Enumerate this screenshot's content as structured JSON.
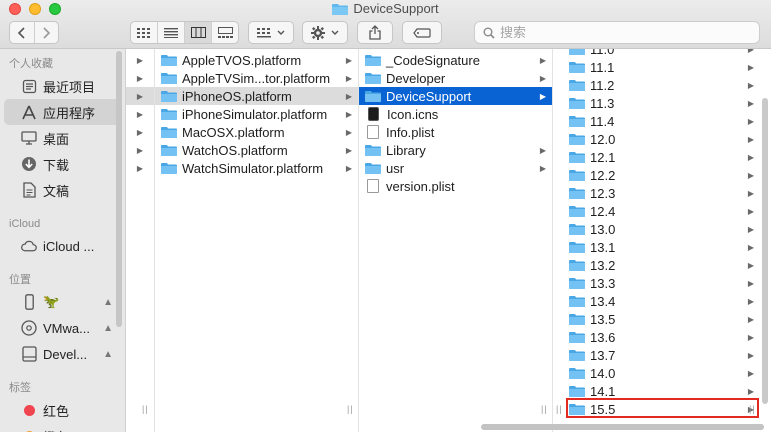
{
  "window": {
    "title": "DeviceSupport"
  },
  "toolbar": {
    "back_icon": "chevron-left-icon",
    "forward_icon": "chevron-right-icon",
    "view_icons": [
      "grid-view-icon",
      "list-view-icon",
      "column-view-icon",
      "gallery-view-icon"
    ],
    "active_view": "column",
    "search_placeholder": "搜索"
  },
  "sidebar": {
    "favorites_header": "个人收藏",
    "favorites": [
      {
        "label": "最近项目",
        "icon": "recents-icon"
      },
      {
        "label": "应用程序",
        "icon": "applications-icon",
        "selected": true
      },
      {
        "label": "桌面",
        "icon": "desktop-icon"
      },
      {
        "label": "下载",
        "icon": "downloads-icon"
      },
      {
        "label": "文稿",
        "icon": "documents-icon"
      }
    ],
    "icloud_header": "iCloud",
    "icloud": [
      {
        "label": "iCloud ...",
        "icon": "cloud-icon"
      }
    ],
    "locations_header": "位置",
    "locations": [
      {
        "label": "🦖",
        "icon": "iphone-icon"
      },
      {
        "label": "VMwa...",
        "icon": "disc-icon"
      },
      {
        "label": "Devel...",
        "icon": "drive-icon"
      }
    ],
    "tags_header": "标签",
    "tags": [
      {
        "label": "红色",
        "color": "#f0444e"
      },
      {
        "label": "橙色",
        "color": "#f5a030"
      }
    ]
  },
  "columns": {
    "platforms": [
      {
        "name": "AppleTVOS.platform"
      },
      {
        "name": "AppleTVSim...tor.platform"
      },
      {
        "name": "iPhoneOS.platform",
        "selected": true
      },
      {
        "name": "iPhoneSimulator.platform"
      },
      {
        "name": "MacOSX.platform"
      },
      {
        "name": "WatchOS.platform"
      },
      {
        "name": "WatchSimulator.platform"
      }
    ],
    "platform_contents": [
      {
        "name": "_CodeSignature",
        "kind": "folder",
        "arrow": true
      },
      {
        "name": "Developer",
        "kind": "folder",
        "arrow": true
      },
      {
        "name": "DeviceSupport",
        "kind": "folder",
        "arrow": true,
        "selected": true
      },
      {
        "name": "Icon.icns",
        "kind": "icns",
        "arrow": false
      },
      {
        "name": "Info.plist",
        "kind": "doc",
        "arrow": false
      },
      {
        "name": "Library",
        "kind": "folder",
        "arrow": true
      },
      {
        "name": "usr",
        "kind": "folder",
        "arrow": true
      },
      {
        "name": "version.plist",
        "kind": "doc",
        "arrow": false
      }
    ],
    "versions": [
      "11.0",
      "11.1",
      "11.2",
      "11.3",
      "11.4",
      "12.0",
      "12.1",
      "12.2",
      "12.3",
      "12.4",
      "13.0",
      "13.1",
      "13.2",
      "13.3",
      "13.4",
      "13.5",
      "13.6",
      "13.7",
      "14.0",
      "14.1",
      "15.5"
    ],
    "highlighted_version": "15.5"
  },
  "colors": {
    "selection_blue": "#0a63d2",
    "folder_blue": "#5fb8ef",
    "highlight_red": "#e32a21"
  }
}
